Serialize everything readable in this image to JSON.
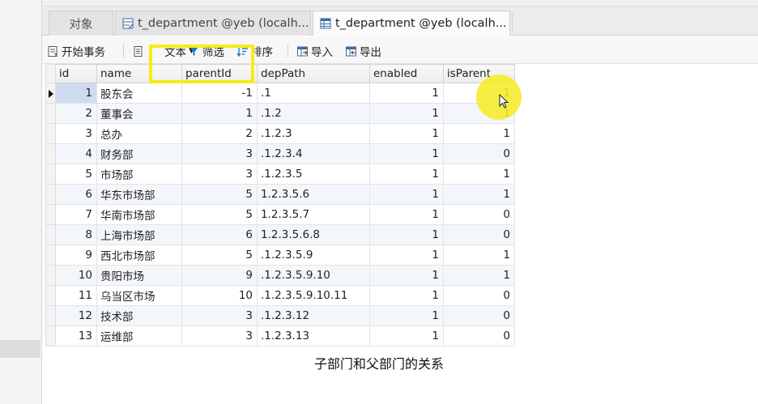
{
  "tabs": [
    {
      "label": "对象",
      "icon": "none"
    },
    {
      "label": "t_department @yeb (localh...",
      "icon": "table-design-icon"
    },
    {
      "label": "t_department @yeb (localh...",
      "icon": "table-icon"
    }
  ],
  "toolbar": {
    "begin_transaction": "开始事务",
    "text": "文本",
    "filter": "筛选",
    "sort": "排序",
    "import": "导入",
    "export": "导出"
  },
  "grid": {
    "columns": [
      "id",
      "name",
      "parentId",
      "depPath",
      "enabled",
      "isParent"
    ],
    "rows": [
      {
        "id": "1",
        "name": "股东会",
        "parentId": "-1",
        "depPath": ".1",
        "enabled": "1",
        "isParent": "1"
      },
      {
        "id": "2",
        "name": "董事会",
        "parentId": "1",
        "depPath": ".1.2",
        "enabled": "1",
        "isParent": "1"
      },
      {
        "id": "3",
        "name": "总办",
        "parentId": "2",
        "depPath": ".1.2.3",
        "enabled": "1",
        "isParent": "1"
      },
      {
        "id": "4",
        "name": "财务部",
        "parentId": "3",
        "depPath": ".1.2.3.4",
        "enabled": "1",
        "isParent": "0"
      },
      {
        "id": "5",
        "name": "市场部",
        "parentId": "3",
        "depPath": ".1.2.3.5",
        "enabled": "1",
        "isParent": "1"
      },
      {
        "id": "6",
        "name": "华东市场部",
        "parentId": "5",
        "depPath": "1.2.3.5.6",
        "enabled": "1",
        "isParent": "1"
      },
      {
        "id": "7",
        "name": "华南市场部",
        "parentId": "5",
        "depPath": "1.2.3.5.7",
        "enabled": "1",
        "isParent": "0"
      },
      {
        "id": "8",
        "name": "上海市场部",
        "parentId": "6",
        "depPath": "1.2.3.5.6.8",
        "enabled": "1",
        "isParent": "0"
      },
      {
        "id": "9",
        "name": "西北市场部",
        "parentId": "5",
        "depPath": ".1.2.3.5.9",
        "enabled": "1",
        "isParent": "1"
      },
      {
        "id": "10",
        "name": "贵阳市场",
        "parentId": "9",
        "depPath": ".1.2.3.5.9.10",
        "enabled": "1",
        "isParent": "1"
      },
      {
        "id": "11",
        "name": "乌当区市场",
        "parentId": "10",
        "depPath": ".1.2.3.5.9.10.11",
        "enabled": "1",
        "isParent": "0"
      },
      {
        "id": "12",
        "name": "技术部",
        "parentId": "3",
        "depPath": ".1.2.3.12",
        "enabled": "1",
        "isParent": "0"
      },
      {
        "id": "13",
        "name": "运维部",
        "parentId": "3",
        "depPath": ".1.2.3.13",
        "enabled": "1",
        "isParent": "0"
      }
    ]
  },
  "caption": "子部门和父部门的关系",
  "colors": {
    "highlight": "#f5ec1a",
    "selected_cell": "#cfdcef"
  }
}
